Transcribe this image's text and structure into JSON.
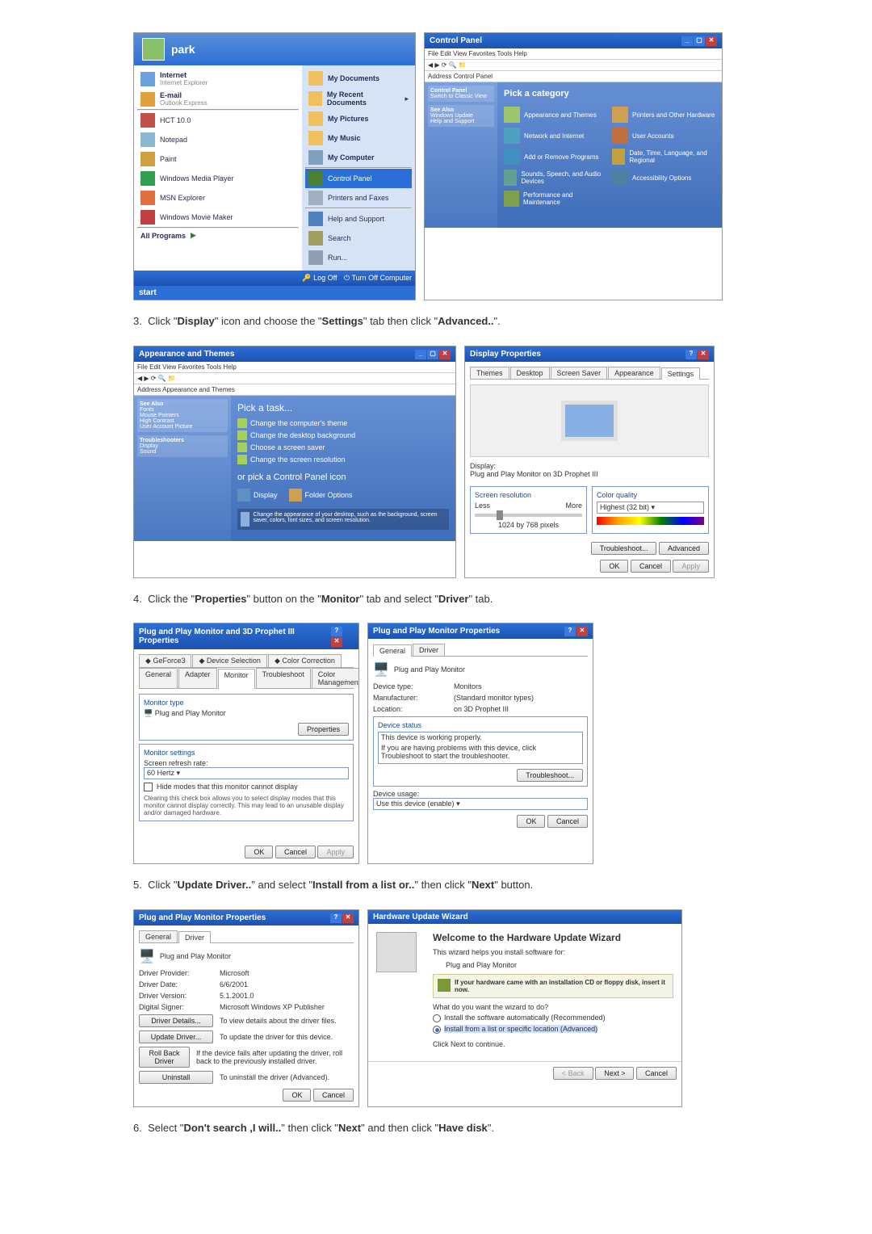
{
  "steps": {
    "s3": "3.  Click \"Display\" icon and choose the \"Settings\" tab then click \"Advanced..\".",
    "s3_bold": [
      "Display",
      "Settings",
      "Advanced.."
    ],
    "s4": "4.  Click the \"Properties\" button on the \"Monitor\" tab and select \"Driver\" tab.",
    "s4_bold": [
      "Properties",
      "Monitor",
      "Driver"
    ],
    "s5": "5.  Click \"Update Driver..\" and select \"Install from a list or..\" then click \"Next\" button.",
    "s5_bold": [
      "Update Driver..",
      "Install from a list or..",
      "Next"
    ],
    "s6": "6.  Select \"Don't search ,I will..\" then click \"Next\" and then click \"Have disk\".",
    "s6_bold": [
      "Don't search ,I will..",
      "Next",
      "Have disk"
    ]
  },
  "startmenu": {
    "user": "park",
    "left_pinned": [
      {
        "title": "Internet",
        "sub": "Internet Explorer"
      },
      {
        "title": "E-mail",
        "sub": "Outlook Express"
      }
    ],
    "left_apps": [
      "HCT 10.0",
      "Notepad",
      "Paint",
      "Windows Media Player",
      "MSN Explorer",
      "Windows Movie Maker"
    ],
    "all_programs": "All Programs",
    "right": [
      "My Documents",
      "My Recent Documents",
      "My Pictures",
      "My Music",
      "My Computer",
      "Control Panel",
      "Printers and Faxes",
      "Help and Support",
      "Search",
      "Run..."
    ],
    "footer": {
      "logoff": "Log Off",
      "turnoff": "Turn Off Computer"
    },
    "start": "start"
  },
  "controlpanel": {
    "title": "Control Panel",
    "menu": "File  Edit  View  Favorites  Tools  Help",
    "addr": "Address  Control Panel",
    "side_title": "Control Panel",
    "side_items": [
      "Switch to Classic View"
    ],
    "see_also": "See Also",
    "see_items": [
      "Windows Update",
      "Help and Support"
    ],
    "pick": "Pick a category",
    "cats": [
      "Appearance and Themes",
      "Printers and Other Hardware",
      "Network and Internet",
      "User Accounts",
      "Add or Remove Programs",
      "Date, Time, Language, and Regional",
      "Sounds, Speech, and Audio Devices",
      "Accessibility Options",
      "Performance and Maintenance",
      ""
    ]
  },
  "appthemes": {
    "title": "Appearance and Themes",
    "pick": "Pick a task...",
    "tasks": [
      "Change the computer's theme",
      "Change the desktop background",
      "Choose a screen saver",
      "Change the screen resolution"
    ],
    "or": "or pick a Control Panel icon",
    "icons": [
      "Display",
      "Folder Options"
    ],
    "hint": "Change the appearance of your desktop, such as the background, screen saver, colors, font sizes, and screen resolution.",
    "side": {
      "seealso": "See Also",
      "troubleshooters": "Troubleshooters",
      "items": [
        "Fonts",
        "Mouse Pointers",
        "High Contrast",
        "User Account Picture",
        "Display",
        "Sound"
      ]
    }
  },
  "displayprops": {
    "title": "Display Properties",
    "tabs": [
      "Themes",
      "Desktop",
      "Screen Saver",
      "Appearance",
      "Settings"
    ],
    "display_label": "Display:",
    "display_name": "Plug and Play Monitor on 3D Prophet III",
    "screenres": "Screen resolution",
    "less": "Less",
    "more": "More",
    "resval": "1024 by 768 pixels",
    "colorq": "Color quality",
    "colorval": "Highest (32 bit)",
    "troubleshoot": "Troubleshoot...",
    "advanced": "Advanced",
    "ok": "OK",
    "cancel": "Cancel",
    "apply": "Apply"
  },
  "pnp3d": {
    "title": "Plug and Play Monitor and 3D Prophet III Properties",
    "tabs_top": [
      "GeForce3",
      "Device Selection",
      "Color Correction"
    ],
    "tabs_bottom": [
      "General",
      "Adapter",
      "Monitor",
      "Troubleshoot",
      "Color Management"
    ],
    "montype_lbl": "Monitor type",
    "montype": "Plug and Play Monitor",
    "propbtn": "Properties",
    "monset": "Monitor settings",
    "refresh_lbl": "Screen refresh rate:",
    "refresh_val": "60 Hertz",
    "hide": "Hide modes that this monitor cannot display",
    "hint": "Clearing this check box allows you to select display modes that this monitor cannot display correctly. This may lead to an unusable display and/or damaged hardware.",
    "ok": "OK",
    "cancel": "Cancel",
    "apply": "Apply"
  },
  "pnpgen": {
    "title": "Plug and Play Monitor Properties",
    "tabs": [
      "General",
      "Driver"
    ],
    "name": "Plug and Play Monitor",
    "devtype_l": "Device type:",
    "devtype": "Monitors",
    "manu_l": "Manufacturer:",
    "manu": "(Standard monitor types)",
    "loc_l": "Location:",
    "loc": "on 3D Prophet III",
    "status_l": "Device status",
    "status": "This device is working properly.",
    "hint": "If you are having problems with this device, click Troubleshoot to start the troubleshooter.",
    "trouble": "Troubleshoot...",
    "usage_l": "Device usage:",
    "usage": "Use this device (enable)",
    "ok": "OK",
    "cancel": "Cancel"
  },
  "pnpdrv": {
    "title": "Plug and Play Monitor Properties",
    "tabs": [
      "General",
      "Driver"
    ],
    "name": "Plug and Play Monitor",
    "prov_l": "Driver Provider:",
    "prov": "Microsoft",
    "date_l": "Driver Date:",
    "date": "6/6/2001",
    "ver_l": "Driver Version:",
    "ver": "5.1.2001.0",
    "sign_l": "Digital Signer:",
    "sign": "Microsoft Windows XP Publisher",
    "dd_btn": "Driver Details...",
    "dd_hint": "To view details about the driver files.",
    "ud_btn": "Update Driver...",
    "ud_hint": "To update the driver for this device.",
    "rb_btn": "Roll Back Driver",
    "rb_hint": "If the device fails after updating the driver, roll back to the previously installed driver.",
    "un_btn": "Uninstall",
    "un_hint": "To uninstall the driver (Advanced).",
    "ok": "OK",
    "cancel": "Cancel"
  },
  "hwwiz": {
    "title": "Hardware Update Wizard",
    "welcome": "Welcome to the Hardware Update Wizard",
    "this": "This wizard helps you install software for:",
    "dev": "Plug and Play Monitor",
    "note": "If your hardware came with an installation CD or floppy disk, insert it now.",
    "what": "What do you want the wizard to do?",
    "opt1": "Install the software automatically (Recommended)",
    "opt2": "Install from a list or specific location (Advanced)",
    "click": "Click Next to continue.",
    "back": "< Back",
    "next": "Next >",
    "cancel": "Cancel"
  }
}
